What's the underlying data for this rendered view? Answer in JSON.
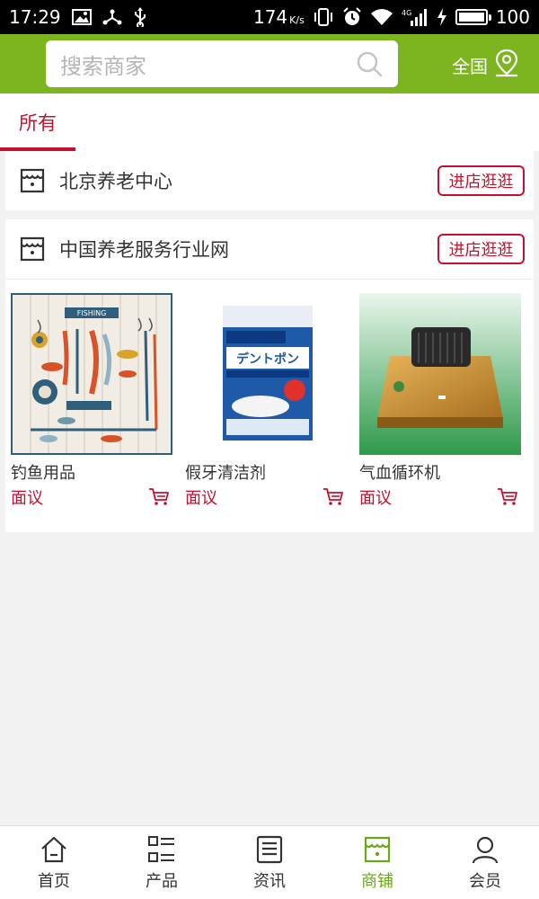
{
  "status_bar": {
    "time": "17:29",
    "net_speed": "174",
    "net_speed_unit": "K/s",
    "network_type": "4G",
    "battery_percent": "100",
    "battery_level": 1.0
  },
  "header": {
    "search_placeholder": "搜索商家",
    "region_label": "全国"
  },
  "tabs": [
    {
      "label": "所有",
      "active": true
    }
  ],
  "stores": [
    {
      "name": "北京养老中心",
      "enter_label": "进店逛逛",
      "products": []
    },
    {
      "name": "中国养老服务行业网",
      "enter_label": "进店逛逛",
      "products": [
        {
          "name": "钓鱼用品",
          "price": "面议",
          "image_label": "FISHING"
        },
        {
          "name": "假牙清洁剂",
          "price": "面议",
          "image_label": "デントポン"
        },
        {
          "name": "气血循环机",
          "price": "面议",
          "image_label": ""
        }
      ]
    }
  ],
  "bottom_nav": [
    {
      "label": "首页",
      "icon": "home-icon",
      "active": false
    },
    {
      "label": "产品",
      "icon": "list-icon",
      "active": false
    },
    {
      "label": "资讯",
      "icon": "news-icon",
      "active": false
    },
    {
      "label": "商铺",
      "icon": "store-icon",
      "active": true
    },
    {
      "label": "会员",
      "icon": "user-icon",
      "active": false
    }
  ],
  "colors": {
    "brand_green": "#7cb51f",
    "accent_red": "#c8102e",
    "nav_active": "#6aa81a"
  }
}
